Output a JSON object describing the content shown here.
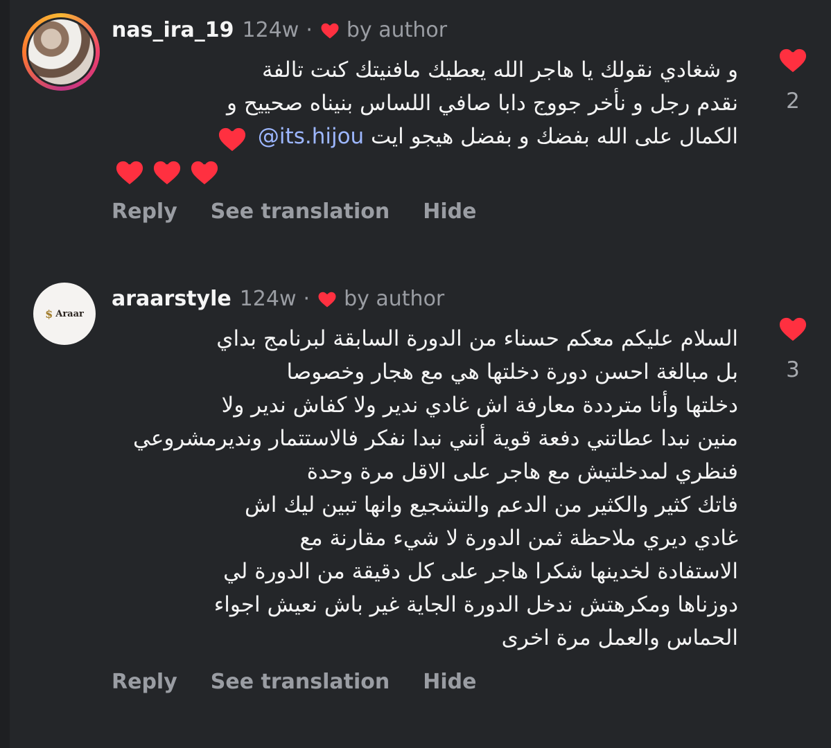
{
  "colors": {
    "background": "#242629",
    "heart": "#ff3040",
    "muted_text": "#9a9da3",
    "mention": "#9db7ff"
  },
  "comments": [
    {
      "username": "nas_ira_19",
      "time": "124w",
      "separator": "·",
      "author_label": "by author",
      "text_lines": [
        "و شغادي نقولك يا هاجر الله يعطيك مافنيتك كنت تالفة",
        "نقدم رجل و نأخر جووج دابا صافي اللساس بنيناه صحييح و",
        "الكمال على الله بفضك  و بفضل هيجو ايت"
      ],
      "mention": "@its.hijou",
      "emoji": "❤️",
      "like_count": "2",
      "actions": {
        "reply": "Reply",
        "translate": "See translation",
        "hide": "Hide"
      }
    },
    {
      "username": "araarstyle",
      "time": "124w",
      "separator": "·",
      "author_label": "by author",
      "avatar_text": "Araar",
      "avatar_symbol": "$",
      "text_lines": [
        "السلام عليكم  معكم حسناء من الدورة السابقة لبرنامج بداي",
        "بل مبالغة احسن دورة دخلتها هي مع هجار وخصوصا",
        "دخلتها وأنا مترددة معارفة اش غادي ندير ولا كفاش ندير ولا",
        "منين نبدا عطاتني دفعة قوية أنني نبدا نفكر فالاستتمار ونديرمشروعي  فنظري لمدخلتيش مع هاجر على الاقل مرة وحدة",
        "فاتك كثير والكثير من الدعم والتشجيع وانها تبين ليك اش",
        "غادي ديري  ملاحظة  ثمن الدورة لا شيء مقارنة مع",
        "الاستفادة لخدينها  شكرا هاجر على كل دقيقة من الدورة لي",
        "دوزناها ومكرهتش ندخل الدورة الجاية غير باش نعيش اجواء",
        "الحماس والعمل مرة اخرى"
      ],
      "like_count": "3",
      "actions": {
        "reply": "Reply",
        "translate": "See translation",
        "hide": "Hide"
      }
    }
  ]
}
